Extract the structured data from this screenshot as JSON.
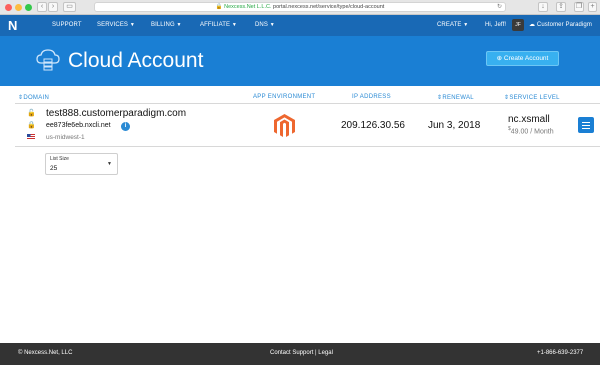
{
  "browser": {
    "owner": "Nexcess.Net L.L.C.",
    "url": "portal.nexcess.net/service/type/cloud-account"
  },
  "topnav": {
    "logo": "N",
    "items": [
      {
        "label": "SUPPORT"
      },
      {
        "label": "SERVICES"
      },
      {
        "label": "BILLING"
      },
      {
        "label": "AFFILIATE"
      },
      {
        "label": "DNS"
      }
    ],
    "create": "CREATE",
    "greeting": "Hi, Jeff!",
    "avatar": "JF",
    "account": "Customer Paradigm"
  },
  "hero": {
    "title": "Cloud Account",
    "create_button": "Create Account"
  },
  "table": {
    "headers": {
      "domain": "DOMAIN",
      "app_env": "APP ENVIRONMENT",
      "ip": "IP ADDRESS",
      "renewal": "RENEWAL",
      "level": "SERVICE LEVEL"
    },
    "row": {
      "domain": "test888.customerparadigm.com",
      "hostname": "ee873fe6eb.nxcli.net",
      "region": "us-midwest-1",
      "ip": "209.126.30.56",
      "renewal": "Jun 3, 2018",
      "plan": "nc.xsmall",
      "price_currency": "$",
      "price": "49.00 / Month"
    }
  },
  "list_size": {
    "label": "List Size",
    "value": "25"
  },
  "footer": {
    "copyright": "© Nexcess.Net, LLC",
    "links": "Contact Support | Legal",
    "phone": "+1-866-639-2377"
  },
  "colors": {
    "nav": "#1969b5",
    "hero": "#1a7fd4",
    "button": "#38b0f0",
    "link": "#2a8ad4",
    "magento": "#ee672f",
    "footer": "#333333"
  }
}
